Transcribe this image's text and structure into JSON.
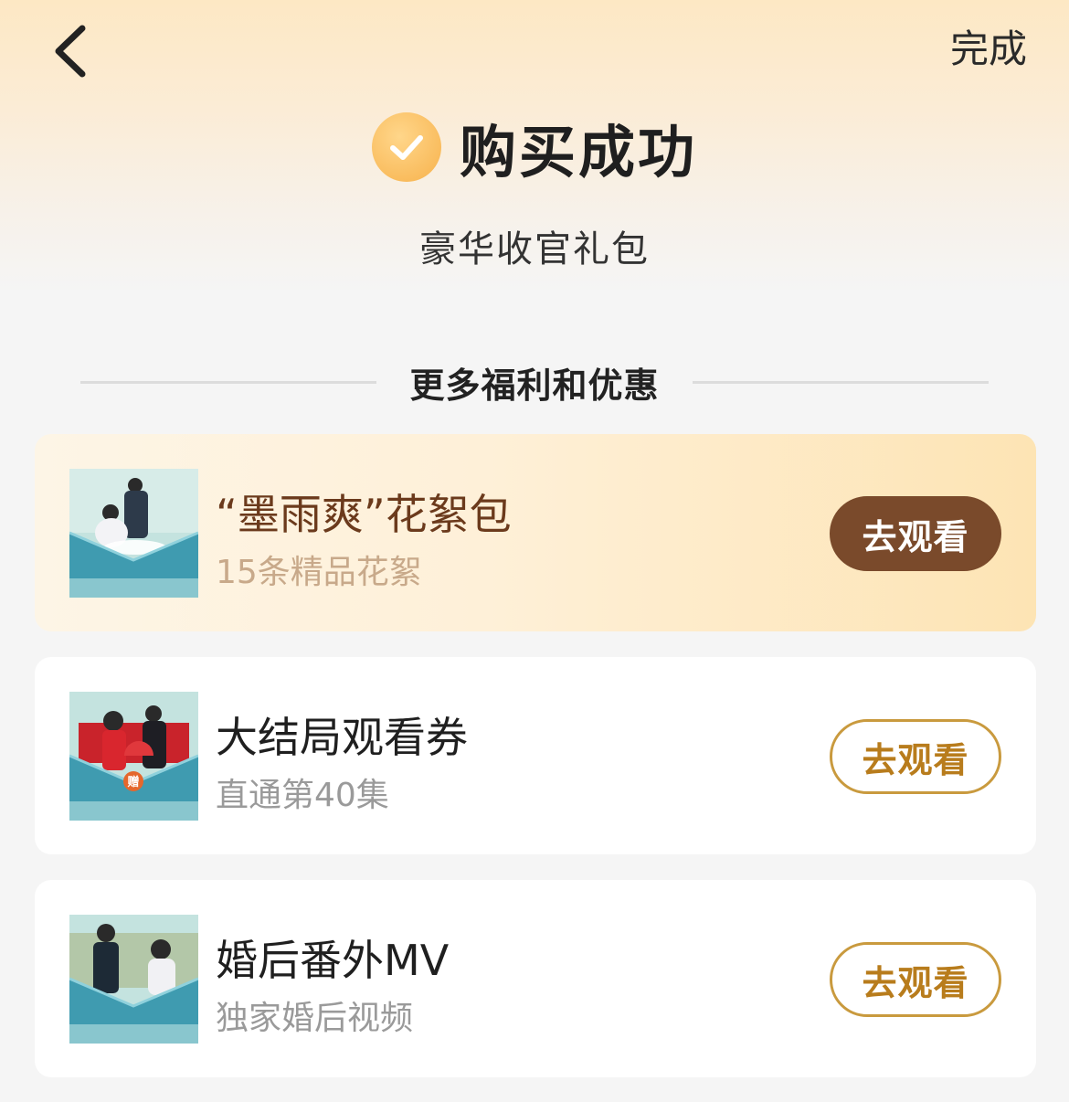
{
  "header": {
    "back_icon": "chevron-left-icon",
    "done_label": "完成"
  },
  "status": {
    "icon": "check-circle-icon",
    "title": "购买成功",
    "package_name": "豪华收官礼包"
  },
  "section": {
    "title": "更多福利和优惠"
  },
  "cards": [
    {
      "title": "“墨雨爽”花絮包",
      "subtitle": "15条精品花絮",
      "button": "去观看",
      "highlight": true
    },
    {
      "title": "大结局观看券",
      "subtitle": "直通第40集",
      "button": "去观看",
      "badge": "赠"
    },
    {
      "title": "婚后番外MV",
      "subtitle": "独家婚后视频",
      "button": "去观看"
    }
  ],
  "colors": {
    "accent_gold": "#c99a3e",
    "accent_brown": "#7a4a2b",
    "check_orange": "#f7b24c"
  }
}
